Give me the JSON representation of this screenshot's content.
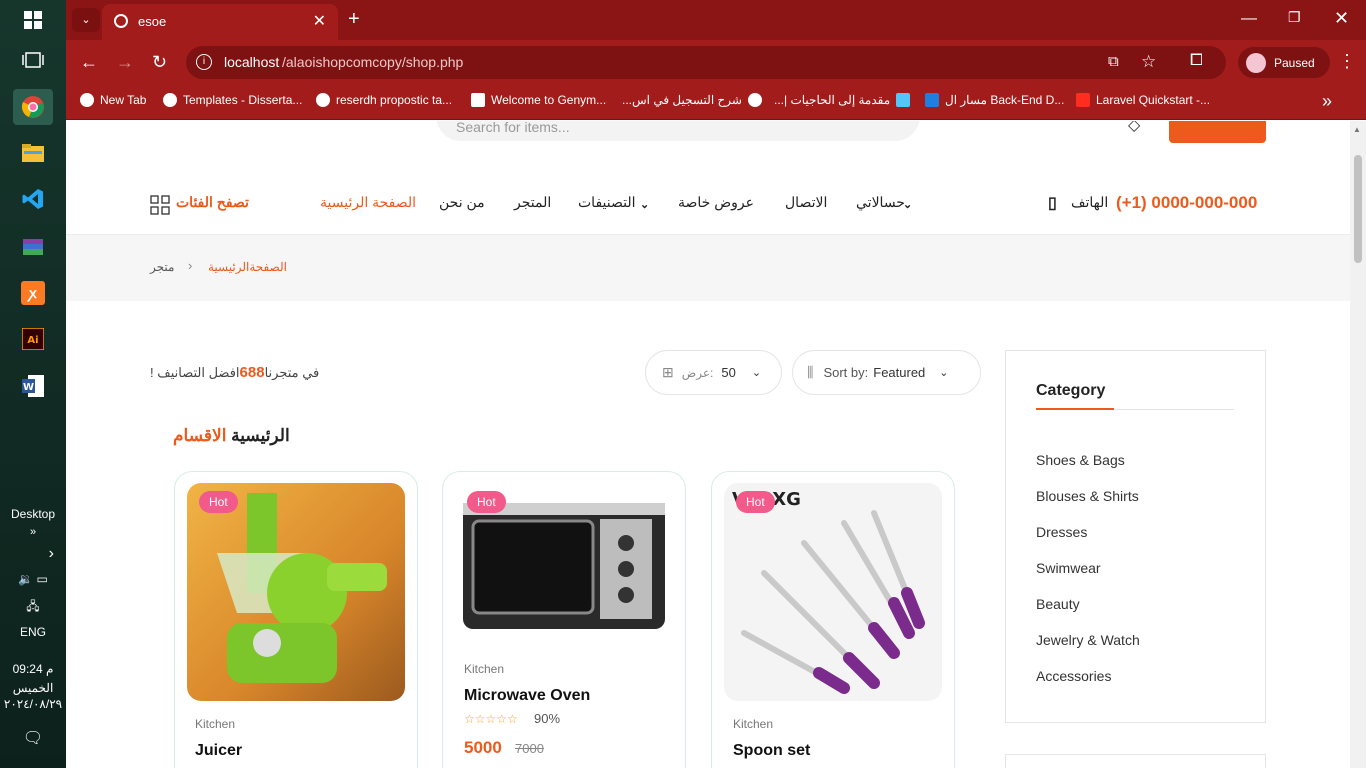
{
  "taskbar": {
    "desktop_label": "Desktop",
    "lang": "ENG",
    "time": "م 09:24",
    "day": "الخميس",
    "date": "٢٠٢٤/٠٨/٢٩"
  },
  "browser": {
    "tab_title": "esoe",
    "url_host": "localhost",
    "url_path": "/alaoishopcomcopy/shop.php",
    "profile_label": "Paused",
    "bookmarks": [
      "New Tab",
      "Templates - Disserta...",
      "reserdh propostic ta...",
      "Welcome to Genym...",
      "شرح التسجيل في اس...",
      "مقدمة إلى الحاجيات |...",
      "مسار ال Back-End D...",
      "Laravel Quickstart -..."
    ]
  },
  "header": {
    "search_placeholder": "Search for items..."
  },
  "nav": {
    "phone": "(+1) 0000-000-000",
    "phone_label": "الهاتف",
    "items": [
      "حسالاتي",
      "الاتصال",
      "عروض خاصة",
      "التصنيفات",
      "المتجر",
      "من نحن",
      "الصفحة الرئيسية"
    ],
    "browse_categories": "تصفح الفئات"
  },
  "breadcrumb": {
    "home": "الصفحةالرئيسية",
    "separator": "›",
    "current": "متجر"
  },
  "toolbar": {
    "result_prefix": "افضل التصانيف",
    "result_count": "688",
    "result_suffix": "! في متجرنا",
    "show_label": "عرض:",
    "show_value": "50",
    "sort_label": "Sort by:",
    "sort_value": "Featured"
  },
  "section": {
    "title_accent": "الاقسام",
    "title_rest": "الرئيسية"
  },
  "products": [
    {
      "badge": "Hot",
      "category": "Kitchen",
      "name": "Juicer"
    },
    {
      "badge": "Hot",
      "category": "Kitchen",
      "name": "Microwave Oven",
      "rating": "90%",
      "price": "5000",
      "old_price": "7000"
    },
    {
      "badge": "Hot",
      "category": "Kitchen",
      "name": "Spoon set",
      "brand_print": "VIISXG"
    }
  ],
  "sidebar": {
    "title": "Category",
    "items": [
      "Shoes & Bags",
      "Blouses & Shirts",
      "Dresses",
      "Swimwear",
      "Beauty",
      "Jewelry & Watch",
      "Accessories"
    ]
  },
  "colors": {
    "accent": "#ee5a1c",
    "chrome": "#a31c1c",
    "hot_badge": "#f15a8a"
  }
}
